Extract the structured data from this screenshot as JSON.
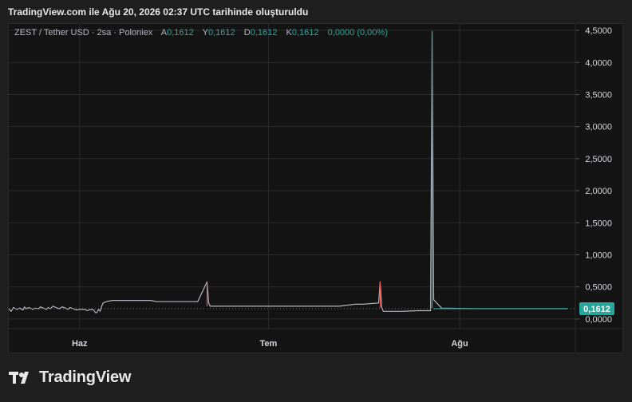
{
  "header": {
    "title": "TradingView.com ile Ağu 20, 2026 02:37 UTC tarihinde oluşturuldu"
  },
  "legend": {
    "symbol": "ZEST / Tether USD · 2sa · Poloniex",
    "open_label": "A",
    "open_value": "0,1612",
    "high_label": "Y",
    "high_value": "0,1612",
    "low_label": "D",
    "low_value": "0,1612",
    "close_label": "K",
    "close_value": "0,1612",
    "change": "0,0000 (0,00%)"
  },
  "brand": {
    "name": "TradingView"
  },
  "colors": {
    "up": "#26a69a",
    "down": "#ef5350",
    "grid": "#2b2b2b",
    "badge": "#26a69a"
  },
  "chart_data": {
    "type": "line",
    "title": "ZEST / Tether USD",
    "x_tick_labels": [
      "Haz",
      "Tem",
      "Ağu"
    ],
    "y_tick_labels": [
      "0,0000",
      "0,5000",
      "1,0000",
      "1,5000",
      "2,0000",
      "2,5000",
      "3,0000",
      "3,5000",
      "4,0000",
      "4,5000"
    ],
    "y_ticks": [
      0,
      0.5,
      1.0,
      1.5,
      2.0,
      2.5,
      3.0,
      3.5,
      4.0,
      4.5
    ],
    "ylim": [
      -0.15,
      4.6
    ],
    "last_price": 0.1612,
    "last_price_label": "0,1612",
    "grid": true,
    "series": [
      {
        "x": [
          0,
          3,
          6,
          10,
          14,
          18,
          20,
          22,
          26,
          30,
          34,
          38,
          40,
          44,
          48,
          50,
          53,
          56,
          60,
          64,
          68,
          72,
          75,
          78,
          82,
          86,
          90,
          92,
          96,
          100,
          104,
          108,
          110,
          112,
          114,
          116,
          118,
          120,
          124,
          128,
          132,
          136,
          140,
          150,
          160,
          170,
          180,
          184,
          188,
          200,
          220,
          240,
          252,
          254,
          256,
          258,
          280,
          300,
          320,
          340,
          360,
          380,
          400,
          420,
          440,
          442,
          450,
          470,
          472,
          474,
          476,
          480,
          500,
          520,
          536,
          538,
          540,
          550,
          600,
          700,
          710
        ],
        "y": [
          0.16,
          0.12,
          0.18,
          0.15,
          0.17,
          0.14,
          0.19,
          0.16,
          0.18,
          0.15,
          0.17,
          0.16,
          0.19,
          0.17,
          0.15,
          0.18,
          0.16,
          0.2,
          0.18,
          0.16,
          0.19,
          0.17,
          0.15,
          0.18,
          0.16,
          0.14,
          0.15,
          0.15,
          0.15,
          0.13,
          0.15,
          0.14,
          0.1,
          0.1,
          0.15,
          0.12,
          0.2,
          0.25,
          0.27,
          0.28,
          0.29,
          0.29,
          0.29,
          0.29,
          0.29,
          0.29,
          0.29,
          0.28,
          0.27,
          0.27,
          0.27,
          0.27,
          0.58,
          0.25,
          0.2,
          0.2,
          0.2,
          0.2,
          0.2,
          0.2,
          0.2,
          0.2,
          0.2,
          0.2,
          0.23,
          0.23,
          0.23,
          0.25,
          0.58,
          0.18,
          0.12,
          0.12,
          0.12,
          0.13,
          0.13,
          4.48,
          0.3,
          0.17,
          0.1612,
          0.1612,
          0.1612
        ]
      }
    ]
  }
}
